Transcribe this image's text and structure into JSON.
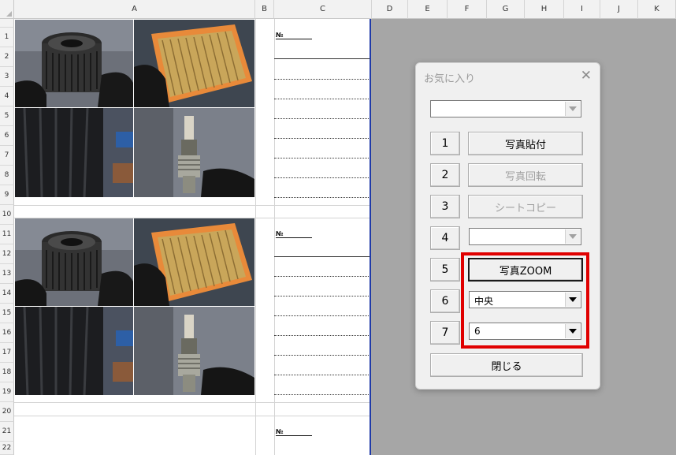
{
  "columns": [
    "A",
    "B",
    "C",
    "D",
    "E",
    "F",
    "G",
    "H",
    "I",
    "J",
    "K"
  ],
  "rows": [
    "1",
    "2",
    "3",
    "4",
    "5",
    "6",
    "7",
    "8",
    "9",
    "10",
    "11",
    "12",
    "13",
    "14",
    "15",
    "16",
    "17",
    "18",
    "19",
    "20",
    "21",
    "22"
  ],
  "sheet": {
    "no_label": "№",
    "photos": [
      "oil-filter",
      "air-filter",
      "tire",
      "spark-plug"
    ]
  },
  "dialog": {
    "title": "お気に入り",
    "close": "✕",
    "top_combo_value": "",
    "rows": [
      {
        "num": "1",
        "label": "写真貼付",
        "enabled": true
      },
      {
        "num": "2",
        "label": "写真回転",
        "enabled": false
      },
      {
        "num": "3",
        "label": "シートコピー",
        "enabled": false
      },
      {
        "num": "4",
        "combo_value": ""
      },
      {
        "num": "5",
        "label": "写真ZOOM",
        "enabled": true
      },
      {
        "num": "6",
        "combo_value": "中央"
      },
      {
        "num": "7",
        "combo_value": "6"
      }
    ],
    "close_button": "閉じる"
  },
  "colors": {
    "highlight": "#e00000",
    "print_border": "#1f3aa8"
  }
}
